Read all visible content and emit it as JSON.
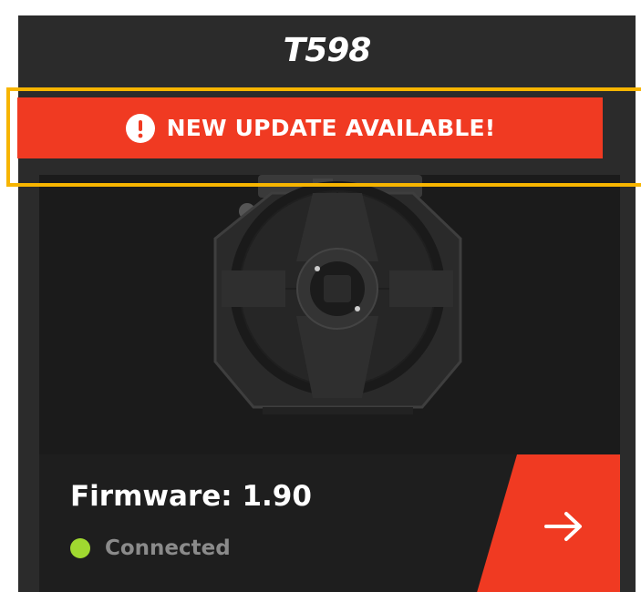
{
  "device": {
    "name": "T598",
    "banner": {
      "icon": "alert-circle-icon",
      "text": "NEW UPDATE AVAILABLE!"
    },
    "image": "t598-wheel-base-image",
    "firmware_label": "Firmware: 1.90",
    "status": {
      "text": "Connected",
      "color": "#a0d930"
    },
    "action_icon": "arrow-right-icon"
  },
  "colors": {
    "card_bg": "#2b2b2b",
    "accent": "#f03a22",
    "highlight": "#f7b500"
  }
}
